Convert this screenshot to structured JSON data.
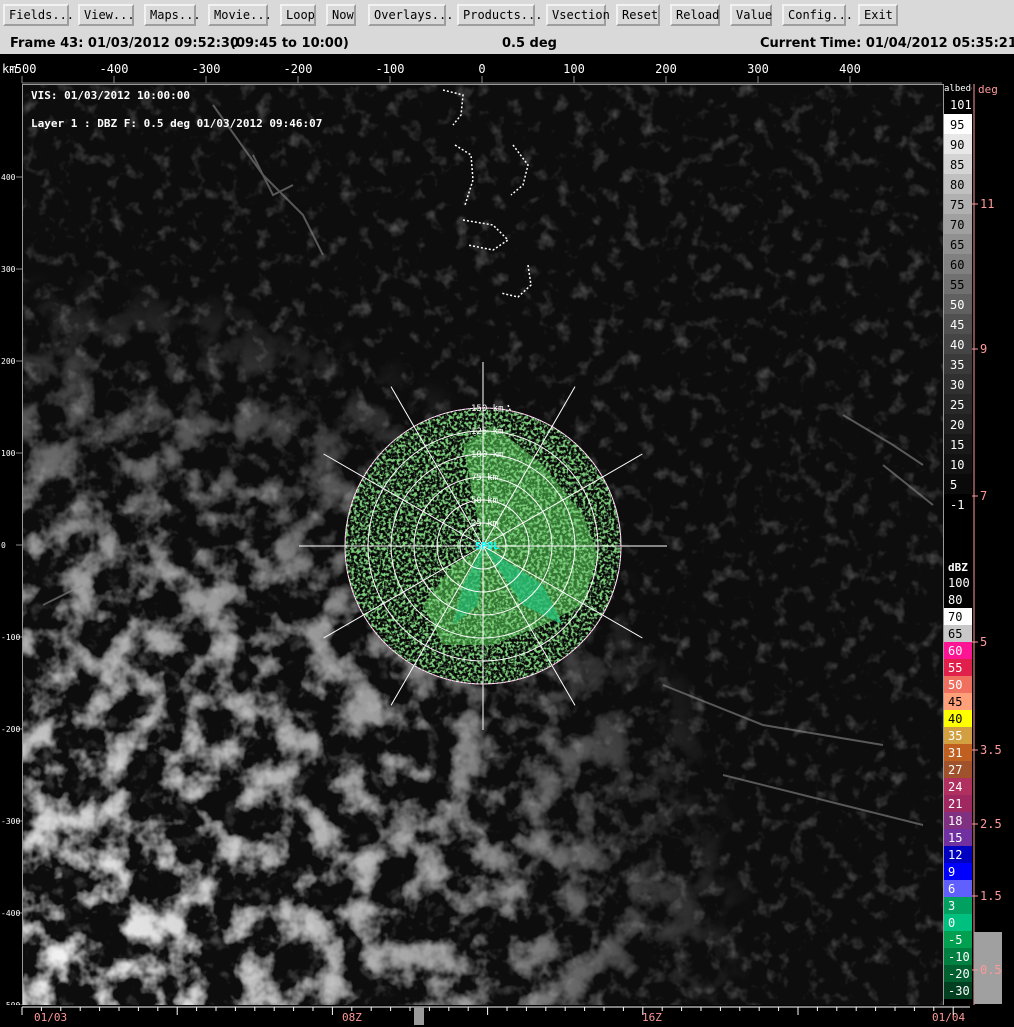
{
  "toolbar": {
    "buttons": [
      "Fields...",
      "View...",
      "Maps...",
      "Movie...",
      "Loop",
      "Now",
      "Overlays...",
      "Products...",
      "Vsection",
      "Reset",
      "Reload",
      "Value",
      "Config...",
      "Exit"
    ]
  },
  "status": {
    "frame": "Frame 43: 01/03/2012 09:52:30",
    "range": "(09:45 to 10:00)",
    "elevation": "0.5 deg",
    "current_time": "Current Time: 01/04/2012 05:35:21"
  },
  "overlay": {
    "vis_label": "VIS: 01/03/2012 10:00:00",
    "layer_label": "Layer 1 : DBZ F: 0.5 deg 01/03/2012 09:46:07"
  },
  "axes": {
    "unit": "km",
    "top_ticks": [
      "-500",
      "-400",
      "-300",
      "-200",
      "-100",
      "0",
      "100",
      "200",
      "300",
      "400"
    ],
    "left_ticks": [
      "400",
      "300",
      "200",
      "100",
      "0",
      "-100",
      "-200",
      "-300",
      "-400",
      "-500"
    ]
  },
  "radar": {
    "station": "SPOL",
    "range_rings": [
      "25 km",
      "50 km",
      "75 km",
      "100 km",
      "125 km",
      "150 km"
    ],
    "ring_color": "#ffffff",
    "echo_color": "#2f8f2f"
  },
  "albedo_scale": {
    "title": "albedo",
    "labels": [
      "101",
      "95",
      "90",
      "85",
      "80",
      "75",
      "70",
      "65",
      "60",
      "55",
      "50",
      "45",
      "40",
      "35",
      "30",
      "25",
      "20",
      "15",
      "10",
      "5",
      "-1"
    ]
  },
  "dbz_scale": {
    "title": "dBZ",
    "labels": [
      "100",
      "80",
      "70",
      "65",
      "60",
      "55",
      "50",
      "45",
      "40",
      "35",
      "31",
      "27",
      "24",
      "21",
      "18",
      "15",
      "12",
      "9",
      "6",
      "3",
      "0",
      "-5",
      "-10",
      "-20",
      "-30"
    ],
    "colors": [
      "#000000",
      "#000000",
      "#ffffff",
      "#c8c8c8",
      "#ff1493",
      "#e0204a",
      "#f07060",
      "#ffa07a",
      "#ffff00",
      "#d2a040",
      "#c06020",
      "#a0522d",
      "#b03060",
      "#a02860",
      "#803080",
      "#7030a0",
      "#0000c0",
      "#0000ff",
      "#6060ff",
      "#00a060",
      "#00c080",
      "#00a050",
      "#008040",
      "#006030",
      "#004020"
    ]
  },
  "deg_scale": {
    "title": "deg",
    "labels": [
      "11",
      "9",
      "7",
      "5",
      "3.5",
      "2.5",
      "1.5",
      "0.5"
    ]
  },
  "timeline": {
    "labels": [
      "01/03",
      "08Z",
      "16Z",
      "01/04"
    ]
  }
}
